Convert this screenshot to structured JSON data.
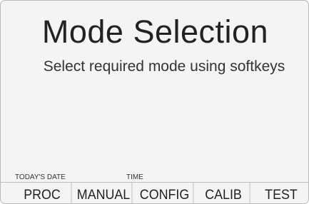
{
  "screen": {
    "title": "Mode Selection",
    "subtitle": "Select required mode using softkeys"
  },
  "status": {
    "date_label": "TODAY'S DATE",
    "time_label": "TIME"
  },
  "softkeys": [
    {
      "label": "PROC"
    },
    {
      "label": "MANUAL"
    },
    {
      "label": "CONFIG"
    },
    {
      "label": "CALIB"
    },
    {
      "label": "TEST"
    }
  ]
}
